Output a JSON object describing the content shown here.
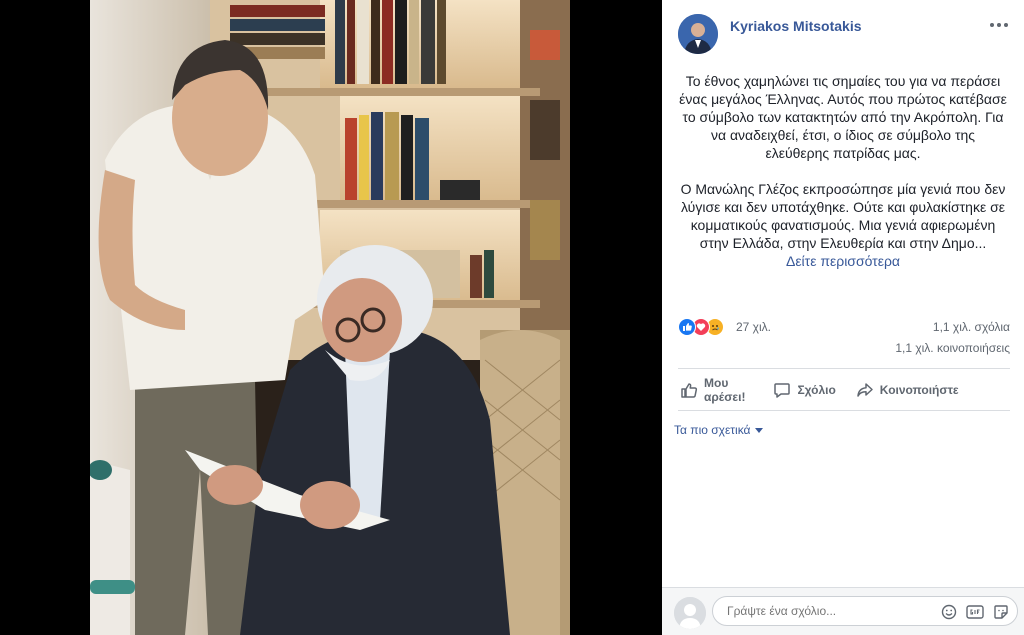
{
  "post": {
    "author": "Kyriakos Mitsotakis",
    "paragraphs": [
      "Το έθνος χαμηλώνει τις σημαίες του για να περάσει ένας μεγάλος Έλληνας. Αυτός που πρώτος κατέβασε το σύμβολο των κατακτητών από την Ακρόπολη. Για να αναδειχθεί, έτσι, ο ίδιος σε σύμβολο της ελεύθερης πατρίδας μας.",
      "Ο Μανώλης Γλέζος εκπροσώπησε μία γενιά που δεν λύγισε και δεν υποτάχθηκε. Ούτε και φυλακίστηκε σε κομματικούς φανατισμούς. Μια γενιά αφιερωμένη στην Ελλάδα, στην Ελευθερία και στην Δημο..."
    ],
    "see_more": "Δείτε περισσότερα"
  },
  "stats": {
    "reactions": "27 χιλ.",
    "comments": "1,1 χιλ. σχόλια",
    "shares": "1,1 χιλ. κοινοποιήσεις"
  },
  "actions": {
    "like_line1": "Μου",
    "like_line2": "αρέσει!",
    "comment": "Σχόλιο",
    "share": "Κοινοποιήστε"
  },
  "sort": {
    "label": "Τα πιο σχετικά"
  },
  "comment_box": {
    "placeholder": "Γράψτε ένα σχόλιο..."
  },
  "icons": {
    "more": "more-icon",
    "like": "thumbs-up-icon",
    "comment": "comment-bubble-icon",
    "share": "share-arrow-icon",
    "emoji": "emoji-icon",
    "gif": "gif-icon",
    "sticker": "sticker-icon"
  },
  "colors": {
    "link": "#385898",
    "text": "#1d2129",
    "muted": "#606770",
    "like": "#1877f2",
    "love": "#f33e58",
    "sad": "#f7b125"
  }
}
